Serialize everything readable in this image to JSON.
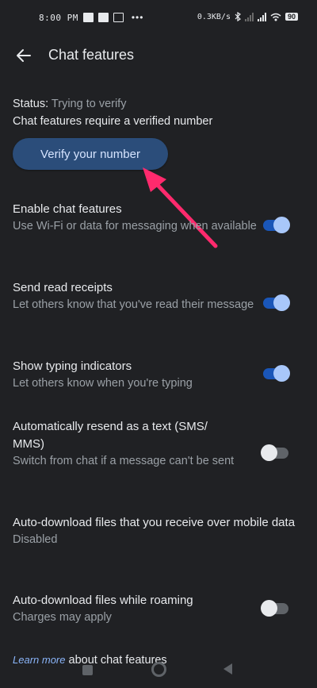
{
  "status_bar": {
    "time": "8:00 PM",
    "net_speed": "0.3KB/s",
    "battery": "90",
    "more_dots": "•••"
  },
  "appbar": {
    "title": "Chat features",
    "back_icon": "arrow-back-icon"
  },
  "status": {
    "label": "Status:",
    "value": "Trying to verify",
    "description": "Chat features require a verified number"
  },
  "verify_button": {
    "label": "Verify your number"
  },
  "settings": [
    {
      "title": "Enable chat features",
      "subtitle": "Use Wi-Fi or data for messaging when available",
      "toggle": true
    },
    {
      "title": "Send read receipts",
      "subtitle": "Let others know that you've read their message",
      "toggle": true
    },
    {
      "title": "Show typing indicators",
      "subtitle": "Let others know when you're typing",
      "toggle": true
    },
    {
      "title": "Automatically resend as a text (SMS/ MMS)",
      "subtitle": "Switch from chat if a message can't be sent",
      "toggle": false
    },
    {
      "title": "Auto-download files that you receive over mobile data",
      "subtitle": "Disabled"
    },
    {
      "title": "Auto-download files while roaming",
      "subtitle": "Charges may apply",
      "toggle": false
    }
  ],
  "footer": {
    "link_text": "Learn more",
    "text": "about chat features"
  },
  "colors": {
    "background": "#202124",
    "accent": "#8ab4f8",
    "annotation_arrow": "#ff2a6d"
  }
}
